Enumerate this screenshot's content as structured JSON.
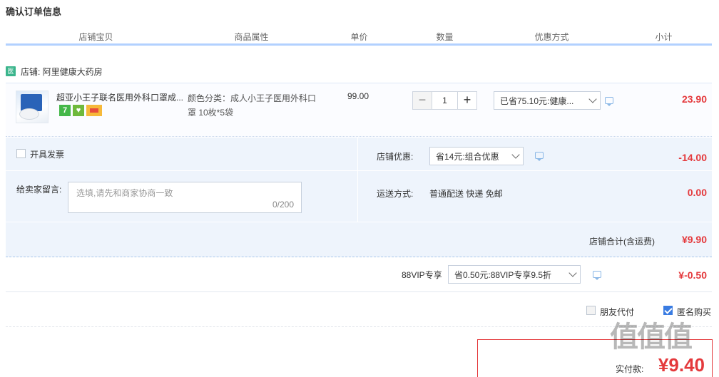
{
  "title": "确认订单信息",
  "columns": [
    "店铺宝贝",
    "商品属性",
    "单价",
    "数量",
    "优惠方式",
    "小计"
  ],
  "shop": {
    "icon": "医",
    "label": "店铺: 阿里健康大药房"
  },
  "item": {
    "title": "超亚小王子联名医用外科口罩成...",
    "badges": [
      "7",
      "",
      ""
    ],
    "attr": "颜色分类：成人小王子医用外科口罩 10枚*5袋",
    "price": "99.00",
    "qty_minus": "−",
    "qty": "1",
    "qty_plus": "+",
    "discount": "已省75.10元:健康...",
    "subtotal": "23.90"
  },
  "options": {
    "invoice_label": "开具发票",
    "memo_label": "给卖家留言:",
    "memo_placeholder": "选填,请先和商家协商一致",
    "memo_count": "0/200",
    "shop_discount_label": "店铺优惠:",
    "shop_discount_value": "省14元:组合优惠",
    "shop_discount_amount": "-14.00",
    "shipping_label": "运送方式:",
    "shipping_value": "普通配送 快递 免邮",
    "shipping_amount": "0.00"
  },
  "total": {
    "label": "店铺合计(含运费)",
    "value": "¥9.90"
  },
  "vip": {
    "label": "88VIP专享",
    "value": "省0.50元:88VIP专享9.5折",
    "amount": "¥-0.50"
  },
  "friend_pay": "朋友代付",
  "anonymous": "匿名购买",
  "pay": {
    "label": "实付款:",
    "amount": "¥9.40"
  },
  "watermark": "值值值"
}
